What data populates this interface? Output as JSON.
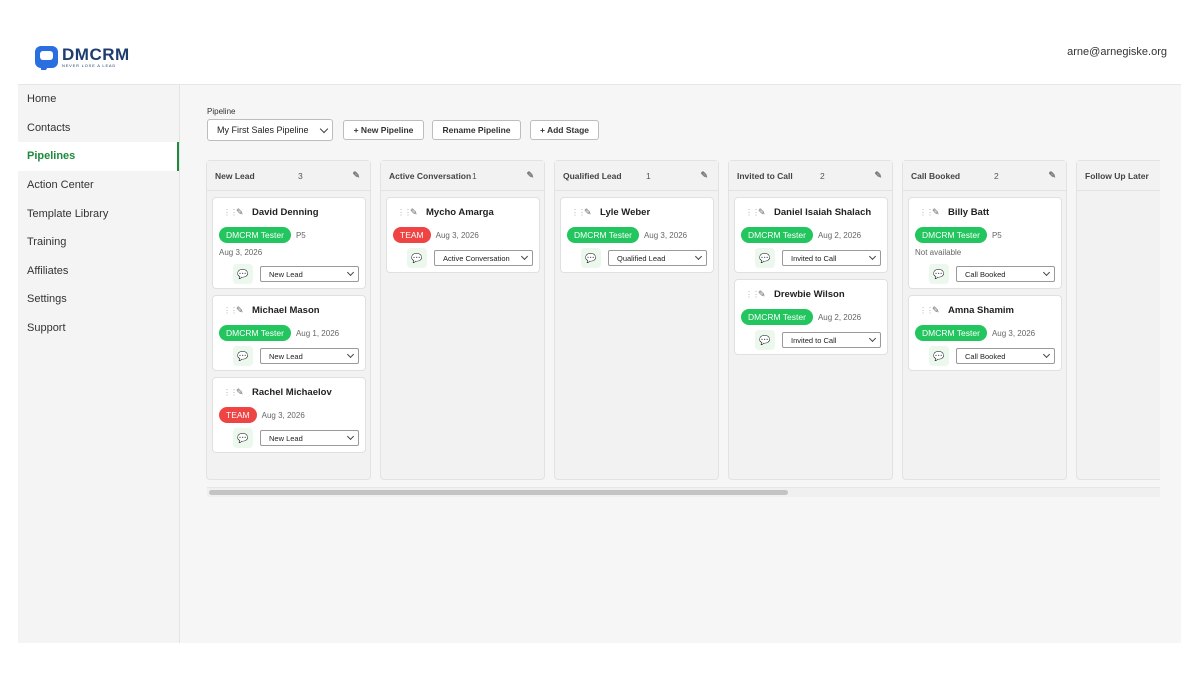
{
  "header": {
    "logo_name": "DMCRM",
    "logo_tagline": "NEVER LOSE A LEAD",
    "user_email": "arne@arnegiske.org"
  },
  "sidebar": {
    "items": [
      {
        "label": "Home"
      },
      {
        "label": "Contacts"
      },
      {
        "label": "Pipelines",
        "active": true
      },
      {
        "label": "Action Center"
      },
      {
        "label": "Template Library"
      },
      {
        "label": "Training"
      },
      {
        "label": "Affiliates"
      },
      {
        "label": "Settings"
      },
      {
        "label": "Support"
      }
    ]
  },
  "toolbar": {
    "pipeline_label": "Pipeline",
    "pipeline_selected": "My First Sales Pipeline",
    "new_pipeline": "+ New Pipeline",
    "rename_pipeline": "Rename Pipeline",
    "add_stage": "+ Add Stage"
  },
  "icons": {
    "drag": "drag-handle-icon",
    "edit": "pencil-icon",
    "message": "chat-bubble-icon",
    "dropdown": "chevron-down-icon"
  },
  "colors": {
    "active_nav": "#1d8a3c",
    "badge_green": "#22c55e",
    "badge_red": "#ef4444"
  },
  "columns": [
    {
      "title": "New Lead",
      "count": "3",
      "cards": [
        {
          "name": "David Denning",
          "badge": "DMCRM Tester",
          "badge_color": "green",
          "meta": "P5",
          "subline": "Aug 3, 2026",
          "stage": "New Lead"
        },
        {
          "name": "Michael Mason",
          "badge": "DMCRM Tester",
          "badge_color": "green",
          "meta": "Aug 1, 2026",
          "subline": "",
          "stage": "New Lead"
        },
        {
          "name": "Rachel Michaelov",
          "badge": "TEAM",
          "badge_color": "red",
          "meta": "Aug 3, 2026",
          "subline": "",
          "stage": "New Lead"
        }
      ]
    },
    {
      "title": "Active Conversation",
      "count": "1",
      "cards": [
        {
          "name": "Mycho Amarga",
          "badge": "TEAM",
          "badge_color": "red",
          "meta": "Aug 3, 2026",
          "subline": "",
          "stage": "Active Conversation"
        }
      ]
    },
    {
      "title": "Qualified Lead",
      "count": "1",
      "cards": [
        {
          "name": "Lyle Weber",
          "badge": "DMCRM Tester",
          "badge_color": "green",
          "meta": "Aug 3, 2026",
          "subline": "",
          "stage": "Qualified Lead"
        }
      ]
    },
    {
      "title": "Invited to Call",
      "count": "2",
      "cards": [
        {
          "name": "Daniel Isaiah Shalach",
          "badge": "DMCRM Tester",
          "badge_color": "green",
          "meta": "Aug 2, 2026",
          "subline": "",
          "stage": "Invited to Call"
        },
        {
          "name": "Drewbie Wilson",
          "badge": "DMCRM Tester",
          "badge_color": "green",
          "meta": "Aug 2, 2026",
          "subline": "",
          "stage": "Invited to Call"
        }
      ]
    },
    {
      "title": "Call Booked",
      "count": "2",
      "cards": [
        {
          "name": "Billy Batt",
          "badge": "DMCRM Tester",
          "badge_color": "green",
          "meta": "P5",
          "subline": "Not available",
          "stage": "Call Booked"
        },
        {
          "name": "Amna Shamim",
          "badge": "DMCRM Tester",
          "badge_color": "green",
          "meta": "Aug 3, 2026",
          "subline": "",
          "stage": "Call Booked"
        }
      ]
    },
    {
      "title": "Follow Up Later",
      "count": "",
      "cards": []
    }
  ]
}
